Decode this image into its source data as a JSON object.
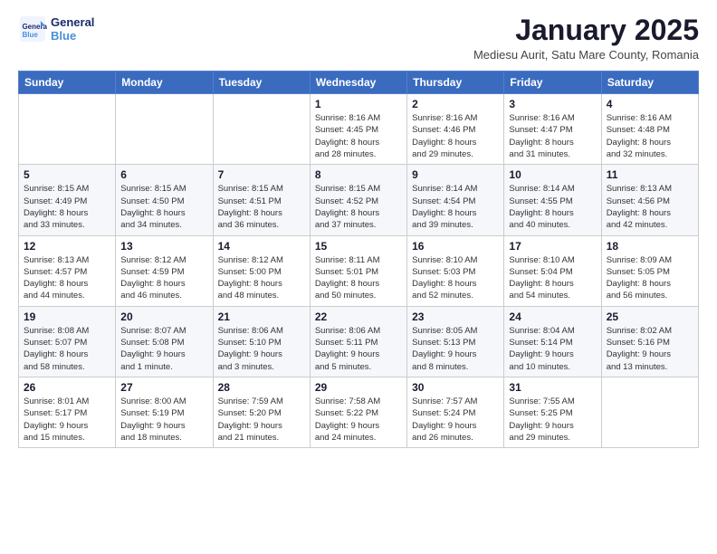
{
  "logo": {
    "line1": "General",
    "line2": "Blue"
  },
  "title": "January 2025",
  "subtitle": "Mediesu Aurit, Satu Mare County, Romania",
  "weekdays": [
    "Sunday",
    "Monday",
    "Tuesday",
    "Wednesday",
    "Thursday",
    "Friday",
    "Saturday"
  ],
  "weeks": [
    [
      {
        "day": "",
        "info": ""
      },
      {
        "day": "",
        "info": ""
      },
      {
        "day": "",
        "info": ""
      },
      {
        "day": "1",
        "info": "Sunrise: 8:16 AM\nSunset: 4:45 PM\nDaylight: 8 hours\nand 28 minutes."
      },
      {
        "day": "2",
        "info": "Sunrise: 8:16 AM\nSunset: 4:46 PM\nDaylight: 8 hours\nand 29 minutes."
      },
      {
        "day": "3",
        "info": "Sunrise: 8:16 AM\nSunset: 4:47 PM\nDaylight: 8 hours\nand 31 minutes."
      },
      {
        "day": "4",
        "info": "Sunrise: 8:16 AM\nSunset: 4:48 PM\nDaylight: 8 hours\nand 32 minutes."
      }
    ],
    [
      {
        "day": "5",
        "info": "Sunrise: 8:15 AM\nSunset: 4:49 PM\nDaylight: 8 hours\nand 33 minutes."
      },
      {
        "day": "6",
        "info": "Sunrise: 8:15 AM\nSunset: 4:50 PM\nDaylight: 8 hours\nand 34 minutes."
      },
      {
        "day": "7",
        "info": "Sunrise: 8:15 AM\nSunset: 4:51 PM\nDaylight: 8 hours\nand 36 minutes."
      },
      {
        "day": "8",
        "info": "Sunrise: 8:15 AM\nSunset: 4:52 PM\nDaylight: 8 hours\nand 37 minutes."
      },
      {
        "day": "9",
        "info": "Sunrise: 8:14 AM\nSunset: 4:54 PM\nDaylight: 8 hours\nand 39 minutes."
      },
      {
        "day": "10",
        "info": "Sunrise: 8:14 AM\nSunset: 4:55 PM\nDaylight: 8 hours\nand 40 minutes."
      },
      {
        "day": "11",
        "info": "Sunrise: 8:13 AM\nSunset: 4:56 PM\nDaylight: 8 hours\nand 42 minutes."
      }
    ],
    [
      {
        "day": "12",
        "info": "Sunrise: 8:13 AM\nSunset: 4:57 PM\nDaylight: 8 hours\nand 44 minutes."
      },
      {
        "day": "13",
        "info": "Sunrise: 8:12 AM\nSunset: 4:59 PM\nDaylight: 8 hours\nand 46 minutes."
      },
      {
        "day": "14",
        "info": "Sunrise: 8:12 AM\nSunset: 5:00 PM\nDaylight: 8 hours\nand 48 minutes."
      },
      {
        "day": "15",
        "info": "Sunrise: 8:11 AM\nSunset: 5:01 PM\nDaylight: 8 hours\nand 50 minutes."
      },
      {
        "day": "16",
        "info": "Sunrise: 8:10 AM\nSunset: 5:03 PM\nDaylight: 8 hours\nand 52 minutes."
      },
      {
        "day": "17",
        "info": "Sunrise: 8:10 AM\nSunset: 5:04 PM\nDaylight: 8 hours\nand 54 minutes."
      },
      {
        "day": "18",
        "info": "Sunrise: 8:09 AM\nSunset: 5:05 PM\nDaylight: 8 hours\nand 56 minutes."
      }
    ],
    [
      {
        "day": "19",
        "info": "Sunrise: 8:08 AM\nSunset: 5:07 PM\nDaylight: 8 hours\nand 58 minutes."
      },
      {
        "day": "20",
        "info": "Sunrise: 8:07 AM\nSunset: 5:08 PM\nDaylight: 9 hours\nand 1 minute."
      },
      {
        "day": "21",
        "info": "Sunrise: 8:06 AM\nSunset: 5:10 PM\nDaylight: 9 hours\nand 3 minutes."
      },
      {
        "day": "22",
        "info": "Sunrise: 8:06 AM\nSunset: 5:11 PM\nDaylight: 9 hours\nand 5 minutes."
      },
      {
        "day": "23",
        "info": "Sunrise: 8:05 AM\nSunset: 5:13 PM\nDaylight: 9 hours\nand 8 minutes."
      },
      {
        "day": "24",
        "info": "Sunrise: 8:04 AM\nSunset: 5:14 PM\nDaylight: 9 hours\nand 10 minutes."
      },
      {
        "day": "25",
        "info": "Sunrise: 8:02 AM\nSunset: 5:16 PM\nDaylight: 9 hours\nand 13 minutes."
      }
    ],
    [
      {
        "day": "26",
        "info": "Sunrise: 8:01 AM\nSunset: 5:17 PM\nDaylight: 9 hours\nand 15 minutes."
      },
      {
        "day": "27",
        "info": "Sunrise: 8:00 AM\nSunset: 5:19 PM\nDaylight: 9 hours\nand 18 minutes."
      },
      {
        "day": "28",
        "info": "Sunrise: 7:59 AM\nSunset: 5:20 PM\nDaylight: 9 hours\nand 21 minutes."
      },
      {
        "day": "29",
        "info": "Sunrise: 7:58 AM\nSunset: 5:22 PM\nDaylight: 9 hours\nand 24 minutes."
      },
      {
        "day": "30",
        "info": "Sunrise: 7:57 AM\nSunset: 5:24 PM\nDaylight: 9 hours\nand 26 minutes."
      },
      {
        "day": "31",
        "info": "Sunrise: 7:55 AM\nSunset: 5:25 PM\nDaylight: 9 hours\nand 29 minutes."
      },
      {
        "day": "",
        "info": ""
      }
    ]
  ]
}
